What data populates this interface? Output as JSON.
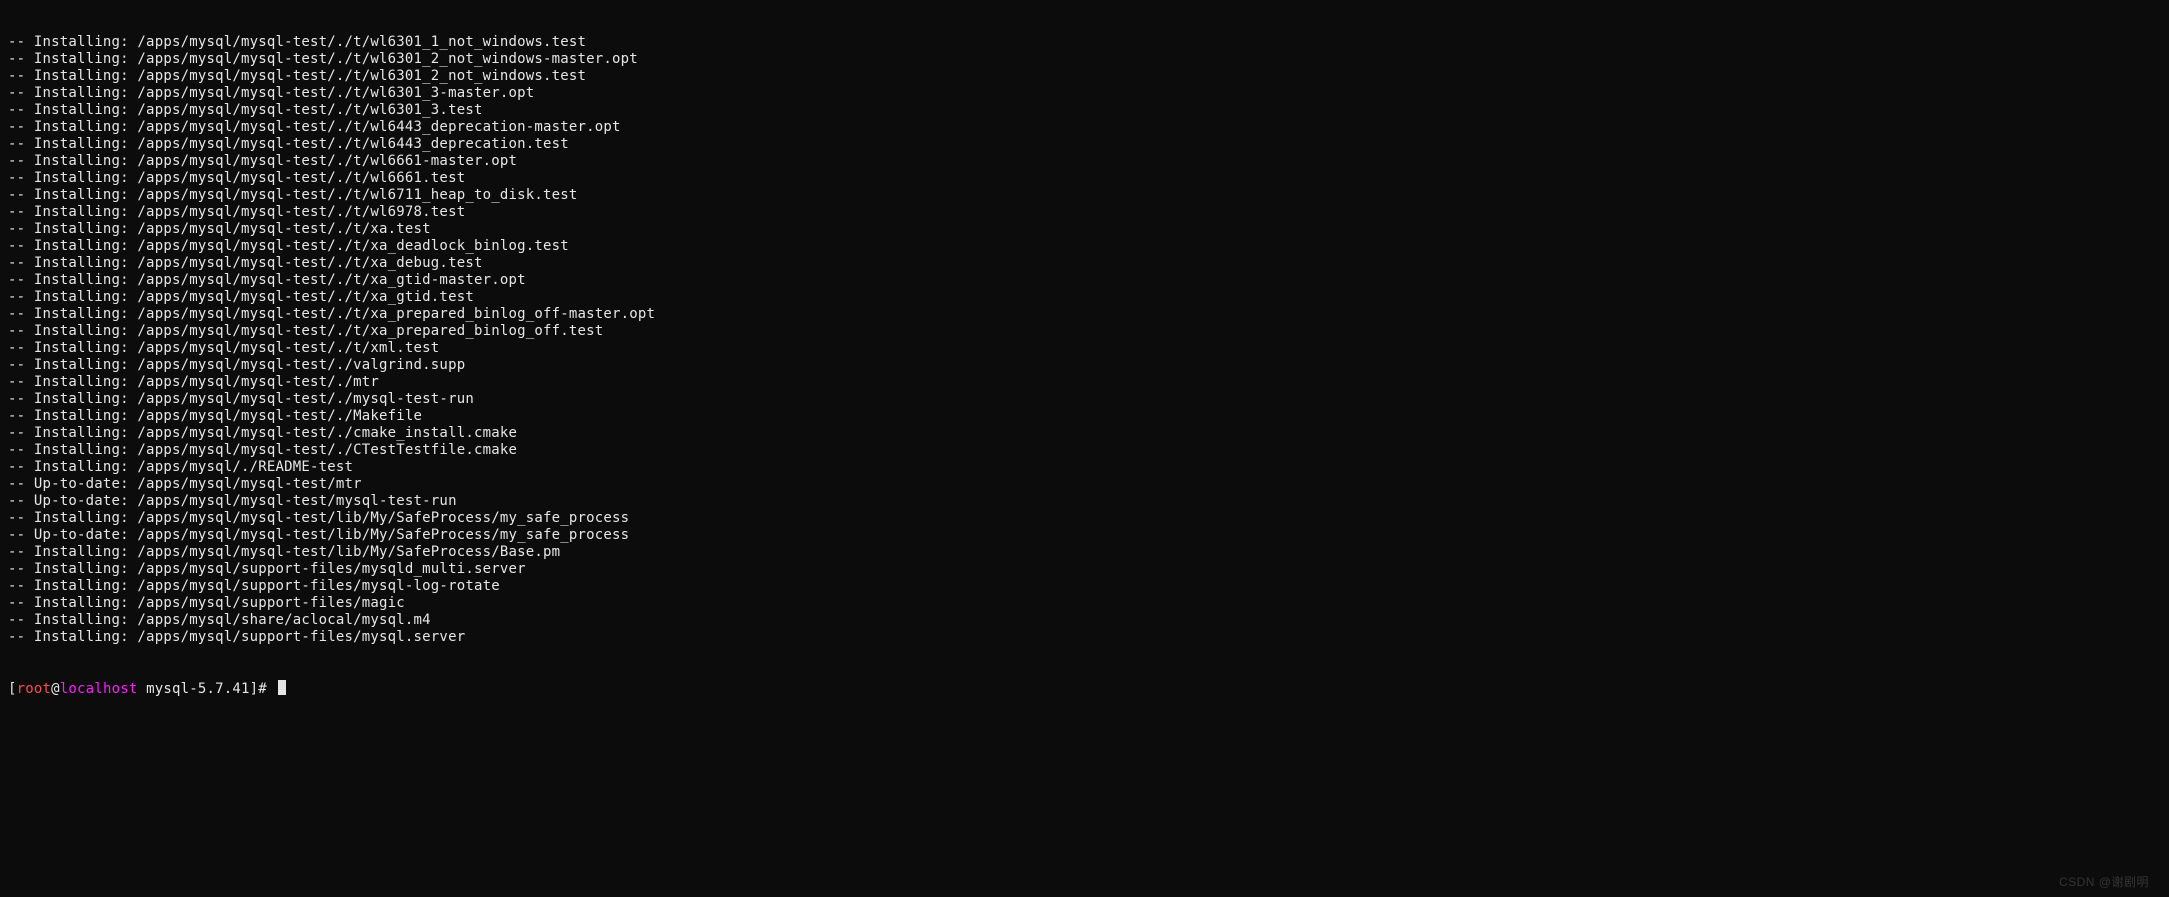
{
  "terminal": {
    "lines": [
      "-- Installing: /apps/mysql/mysql-test/./t/wl6301_1_not_windows.test",
      "-- Installing: /apps/mysql/mysql-test/./t/wl6301_2_not_windows-master.opt",
      "-- Installing: /apps/mysql/mysql-test/./t/wl6301_2_not_windows.test",
      "-- Installing: /apps/mysql/mysql-test/./t/wl6301_3-master.opt",
      "-- Installing: /apps/mysql/mysql-test/./t/wl6301_3.test",
      "-- Installing: /apps/mysql/mysql-test/./t/wl6443_deprecation-master.opt",
      "-- Installing: /apps/mysql/mysql-test/./t/wl6443_deprecation.test",
      "-- Installing: /apps/mysql/mysql-test/./t/wl6661-master.opt",
      "-- Installing: /apps/mysql/mysql-test/./t/wl6661.test",
      "-- Installing: /apps/mysql/mysql-test/./t/wl6711_heap_to_disk.test",
      "-- Installing: /apps/mysql/mysql-test/./t/wl6978.test",
      "-- Installing: /apps/mysql/mysql-test/./t/xa.test",
      "-- Installing: /apps/mysql/mysql-test/./t/xa_deadlock_binlog.test",
      "-- Installing: /apps/mysql/mysql-test/./t/xa_debug.test",
      "-- Installing: /apps/mysql/mysql-test/./t/xa_gtid-master.opt",
      "-- Installing: /apps/mysql/mysql-test/./t/xa_gtid.test",
      "-- Installing: /apps/mysql/mysql-test/./t/xa_prepared_binlog_off-master.opt",
      "-- Installing: /apps/mysql/mysql-test/./t/xa_prepared_binlog_off.test",
      "-- Installing: /apps/mysql/mysql-test/./t/xml.test",
      "-- Installing: /apps/mysql/mysql-test/./valgrind.supp",
      "-- Installing: /apps/mysql/mysql-test/./mtr",
      "-- Installing: /apps/mysql/mysql-test/./mysql-test-run",
      "-- Installing: /apps/mysql/mysql-test/./Makefile",
      "-- Installing: /apps/mysql/mysql-test/./cmake_install.cmake",
      "-- Installing: /apps/mysql/mysql-test/./CTestTestfile.cmake",
      "-- Installing: /apps/mysql/./README-test",
      "-- Up-to-date: /apps/mysql/mysql-test/mtr",
      "-- Up-to-date: /apps/mysql/mysql-test/mysql-test-run",
      "-- Installing: /apps/mysql/mysql-test/lib/My/SafeProcess/my_safe_process",
      "-- Up-to-date: /apps/mysql/mysql-test/lib/My/SafeProcess/my_safe_process",
      "-- Installing: /apps/mysql/mysql-test/lib/My/SafeProcess/Base.pm",
      "-- Installing: /apps/mysql/support-files/mysqld_multi.server",
      "-- Installing: /apps/mysql/support-files/mysql-log-rotate",
      "-- Installing: /apps/mysql/support-files/magic",
      "-- Installing: /apps/mysql/share/aclocal/mysql.m4",
      "-- Installing: /apps/mysql/support-files/mysql.server"
    ],
    "prompt": {
      "bracket": "[",
      "user": "root",
      "at": "@",
      "host": "localhost",
      "sep": " ",
      "dir": "mysql-5.7.41",
      "close": "]# "
    }
  },
  "watermark": "CSDN @谢剧明"
}
